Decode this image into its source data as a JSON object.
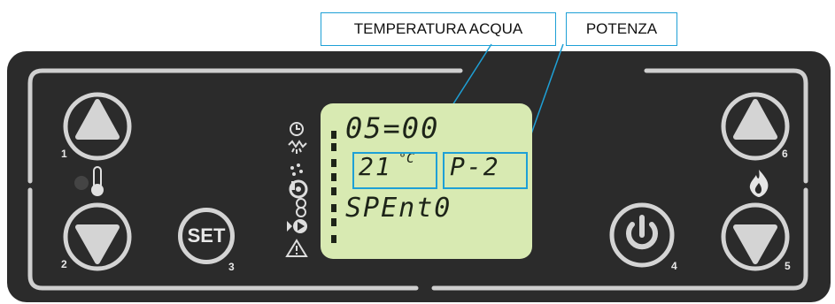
{
  "callouts": {
    "water_temp": "TEMPERATURA ACQUA",
    "power": "POTENZA"
  },
  "display": {
    "time": "05=00",
    "temperature": "21",
    "temperature_unit": "°C",
    "power_level": "P-2",
    "status": "SPEnt0"
  },
  "buttons": {
    "set_label": "SET",
    "numbers": [
      "1",
      "2",
      "3",
      "4",
      "5",
      "6"
    ]
  },
  "icons": [
    "thermometer-icon",
    "flame-icon",
    "power-icon",
    "clock-icon",
    "heat-icon",
    "pellet-icon",
    "fan-icon",
    "warning-icon"
  ],
  "colors": {
    "panel": "#2b2b2b",
    "lcd": "#d8eab2",
    "callout": "#1ea0d6",
    "button": "#d4d4d4"
  }
}
